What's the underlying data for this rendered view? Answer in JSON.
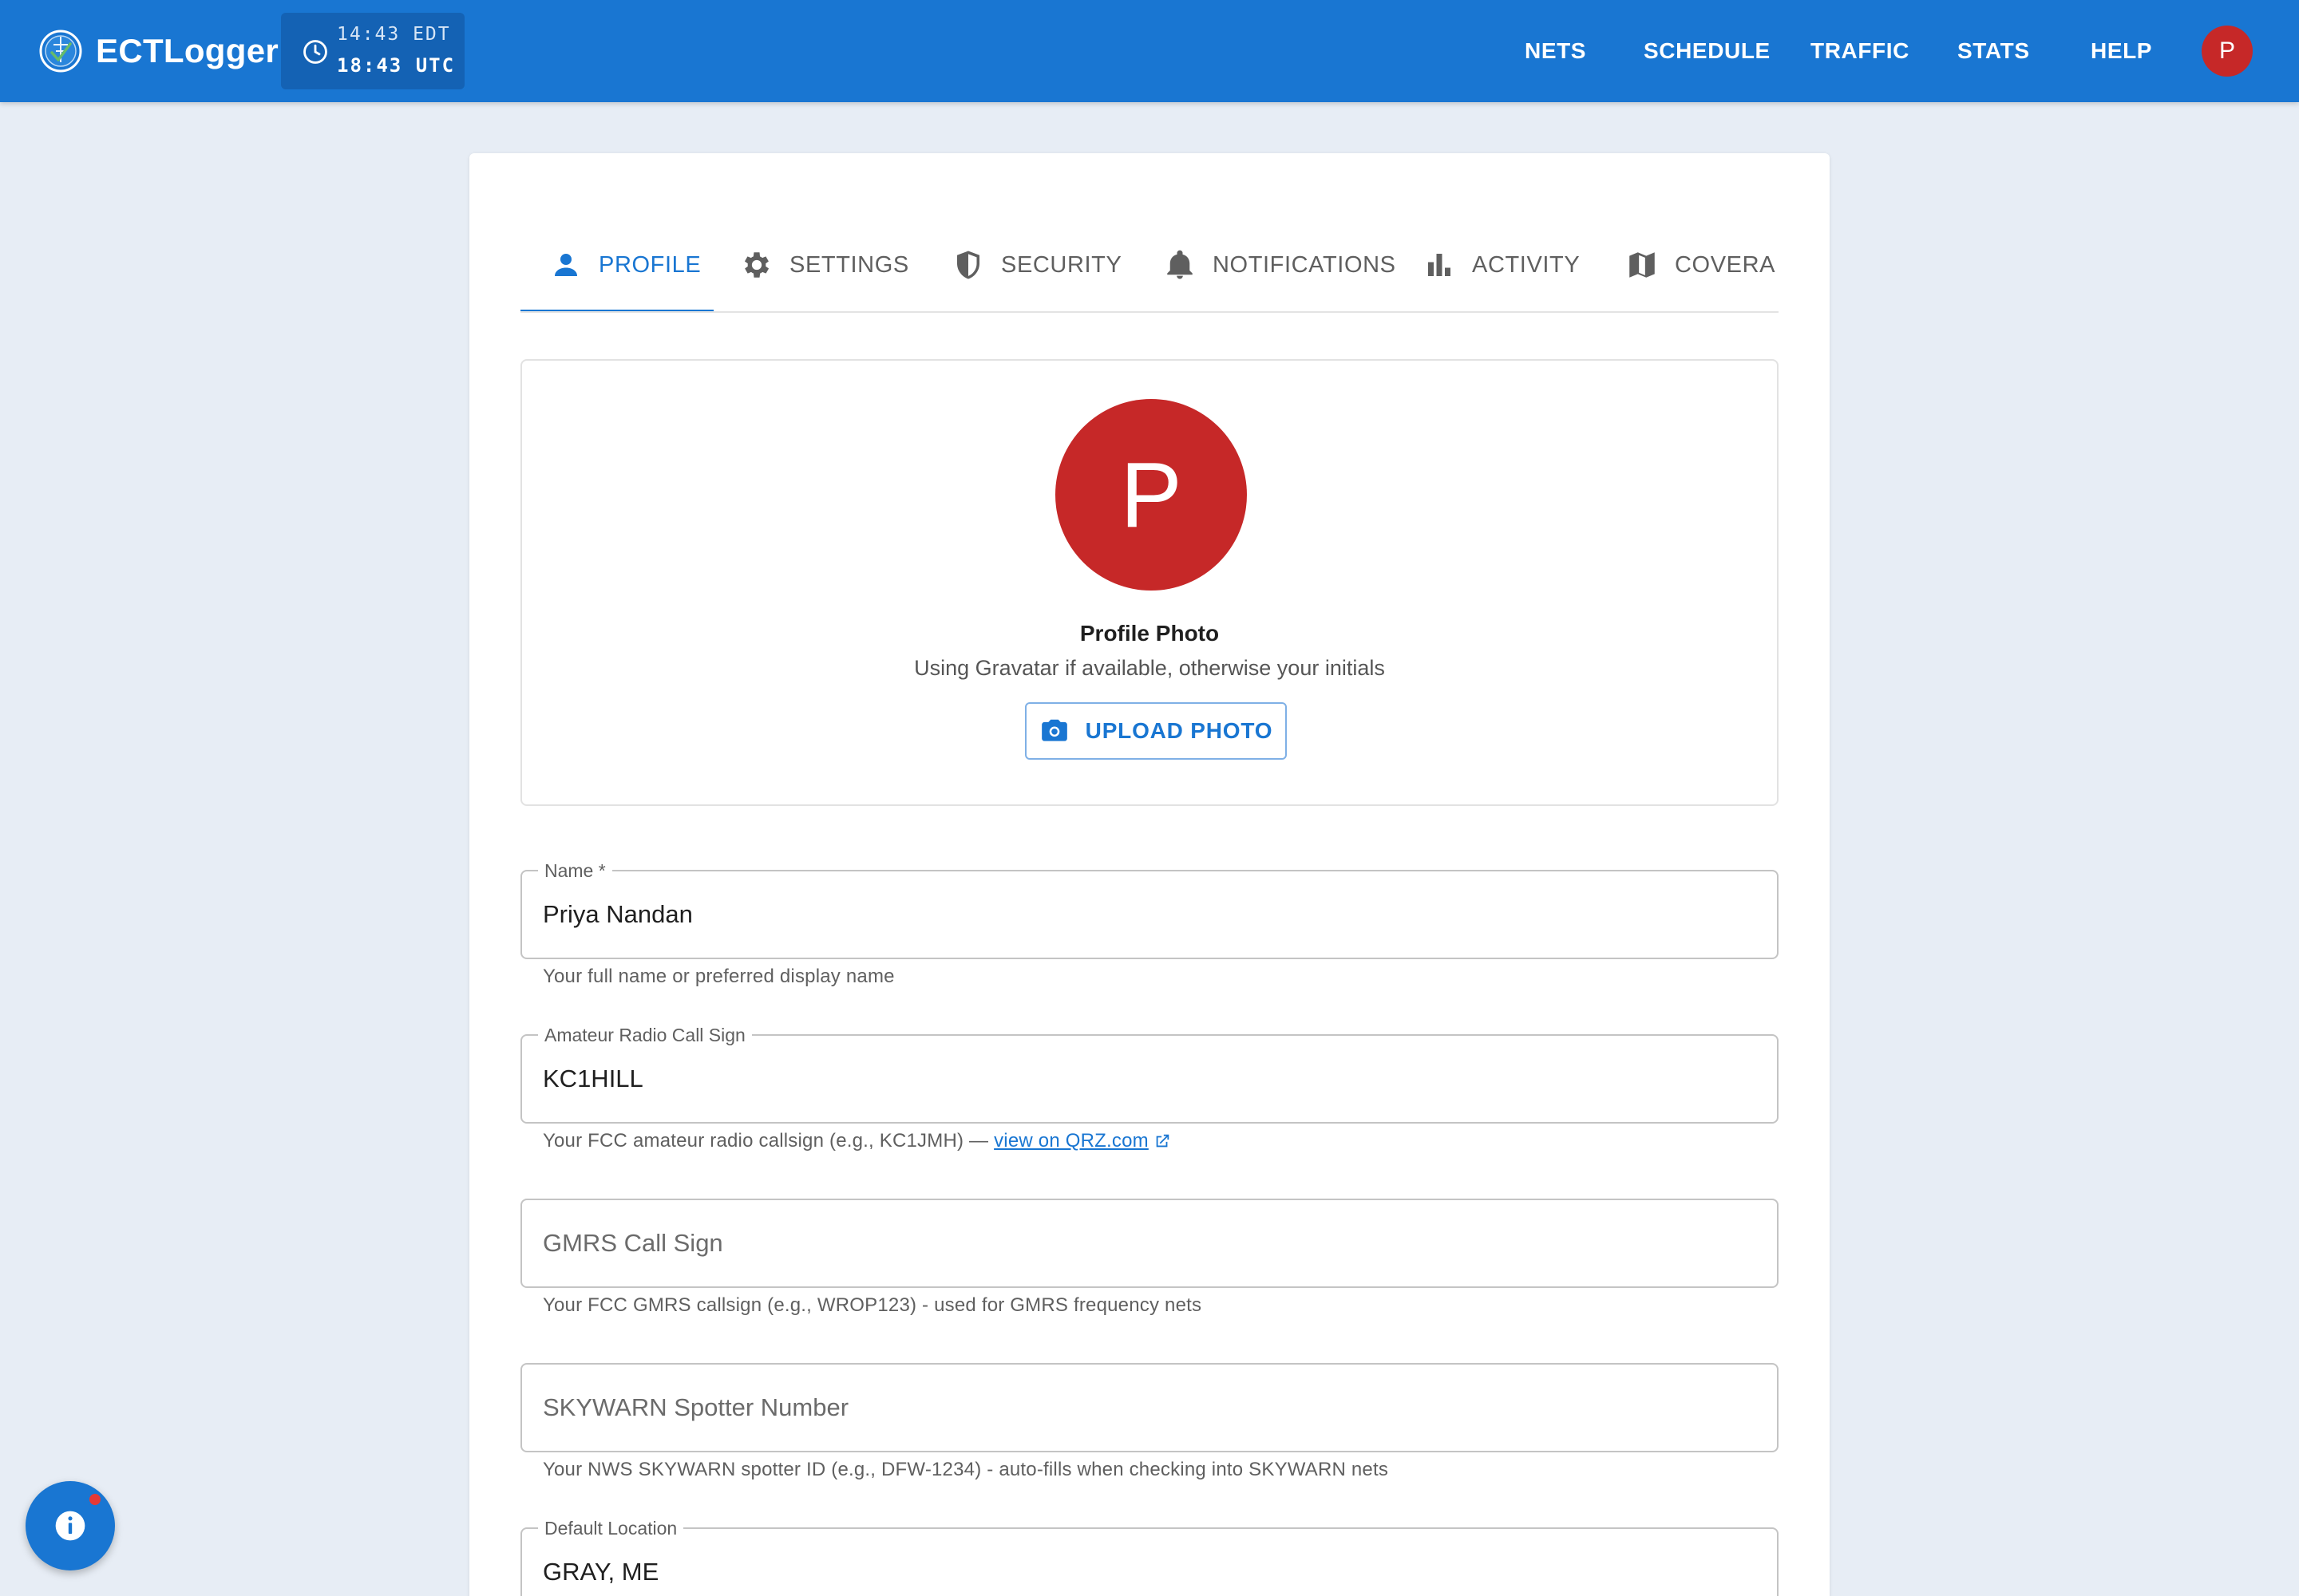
{
  "app": {
    "brand": "ECTLogger",
    "clock_local": "14:43 EDT",
    "clock_utc": "18:43 UTC",
    "user_initial": "P",
    "colors": {
      "primary": "#1976d2",
      "avatar": "#c62828",
      "background": "#e7edf5"
    }
  },
  "nav": {
    "items": [
      {
        "label": "NETS"
      },
      {
        "label": "SCHEDULE"
      },
      {
        "label": "TRAFFIC"
      },
      {
        "label": "STATS"
      },
      {
        "label": "HELP"
      }
    ]
  },
  "tabs": [
    {
      "label": "PROFILE",
      "icon": "person-icon",
      "active": true
    },
    {
      "label": "SETTINGS",
      "icon": "gear-icon",
      "active": false
    },
    {
      "label": "SECURITY",
      "icon": "shield-icon",
      "active": false
    },
    {
      "label": "NOTIFICATIONS",
      "icon": "bell-icon",
      "active": false
    },
    {
      "label": "ACTIVITY",
      "icon": "bar-chart-icon",
      "active": false
    },
    {
      "label": "COVERA",
      "icon": "map-icon",
      "active": false
    }
  ],
  "profile_photo": {
    "initial": "P",
    "title": "Profile Photo",
    "subtitle": "Using Gravatar if available, otherwise your initials",
    "upload_label": "UPLOAD PHOTO"
  },
  "fields": {
    "name": {
      "label": "Name *",
      "value": "Priya Nandan",
      "helper": "Your full name or preferred display name"
    },
    "callsign": {
      "label": "Amateur Radio Call Sign",
      "value": "KC1HILL",
      "helper": "Your FCC amateur radio callsign (e.g., KC1JMH) — ",
      "link": "view on QRZ.com"
    },
    "gmrs": {
      "placeholder": "GMRS Call Sign",
      "helper": "Your FCC GMRS callsign (e.g., WROP123) - used for GMRS frequency nets"
    },
    "skywarn": {
      "placeholder": "SKYWARN Spotter Number",
      "helper": "Your NWS SKYWARN spotter ID (e.g., DFW-1234) - auto-fills when checking into SKYWARN nets"
    },
    "location": {
      "label": "Default Location",
      "value": "GRAY, ME"
    }
  }
}
